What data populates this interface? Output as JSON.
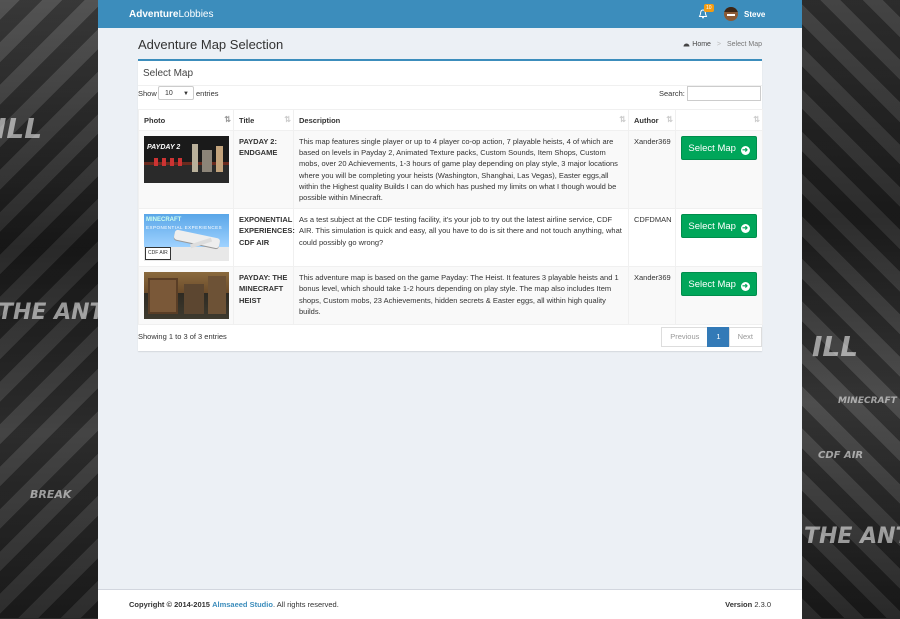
{
  "app": {
    "brand_bold": "Adventure",
    "brand_rest": "Lobbies",
    "user": "Steve",
    "notifications": "10"
  },
  "page": {
    "title": "Adventure Map Selection"
  },
  "breadcrumb": {
    "home": "Home",
    "current": "Select Map"
  },
  "box": {
    "title": "Select Map"
  },
  "table_controls": {
    "show_label": "Show",
    "length_value": "10",
    "entries_label": "entries",
    "search_label": "Search:",
    "search_value": ""
  },
  "table": {
    "headers": [
      "Photo",
      "Title",
      "Description",
      "Author",
      ""
    ],
    "rows": [
      {
        "title": "PAYDAY 2: ENDGAME",
        "description": "This map features single player or up to 4 player co-op action, 7 playable heists, 4 of which are based on levels in Payday 2, Animated Texture packs, Custom Sounds, Item Shops, Custom mobs, over 20 Achievements, 1-3 hours of game play depending on play style, 3 major locations where you will be completing your heists (Washington, Shanghai, Las Vegas), Easter eggs,all within the Highest quality Builds I can do which has pushed my limits on what I though would be possible within Minecraft.",
        "author": "Xander369",
        "action": "Select Map",
        "thumb_text": "PAYDAY 2"
      },
      {
        "title": "EXPONENTIAL EXPERIENCES: CDF AIR",
        "description": "As a test subject at the CDF testing facility, it's your job to try out the latest airline service, CDF AIR. This simulation is quick and easy, all you have to do is sit there and not touch anything, what could possibly go wrong?",
        "author": "CDFDMAN",
        "action": "Select Map",
        "thumb_text1": "MINECRAFT",
        "thumb_text2": "EXPONENTIAL EXPERIENCES",
        "thumb_text3": "CDF AIR"
      },
      {
        "title": "PAYDAY: THE MINECRAFT HEIST",
        "description": "This adventure map is based on the game Payday: The Heist. It features 3 playable heists and 1 bonus level, which should take 1-2 hours depending on play style. The map also includes Item shops, Custom mobs, 23 Achievements, hidden secrets & Easter eggs, all within high quality builds.",
        "author": "Xander369",
        "action": "Select Map"
      }
    ]
  },
  "table_info": "Showing 1 to 3 of 3 entries",
  "pagination": {
    "previous": "Previous",
    "current": "1",
    "next": "Next"
  },
  "footer": {
    "copy_prefix": "Copyright © 2014-2015",
    "company": "Almsaeed Studio",
    "copy_suffix": ". All rights reserved.",
    "version_label": "Version",
    "version": "2.3.0"
  },
  "background": {
    "left_text1": "ILL",
    "left_text2": "THE ANTH",
    "left_text3": "BREAK",
    "right_text1": "THE ANTH",
    "right_text2": "ILL",
    "right_text3": "MINECRAFT",
    "right_text4": "CDF AIR"
  },
  "colors": {
    "navbar": "#3c8dbc",
    "accent_button": "#00a65a",
    "content_bg": "#ecf0f5",
    "pager_active": "#337ab7"
  }
}
